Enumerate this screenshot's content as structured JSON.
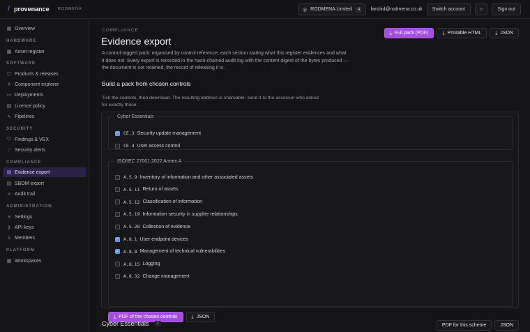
{
  "brand": {
    "name": "provenance",
    "org": "RODMENA"
  },
  "top": {
    "tenant": "RODMENA Limited",
    "tenant_count": "4",
    "email": "farshid@rodmena.co.uk",
    "switch": "Switch account",
    "signout": "Sign out"
  },
  "sidebar": {
    "overview": "Overview",
    "sec_hardware": "HARDWARE",
    "asset_register": "Asset register",
    "sec_software": "SOFTWARE",
    "products": "Products & releases",
    "component_explorer": "Component explorer",
    "deployments": "Deployments",
    "licence_policy": "Licence policy",
    "pipelines": "Pipelines",
    "sec_security": "SECURITY",
    "findings": "Findings & VEX",
    "security_alerts": "Security alerts",
    "sec_compliance": "COMPLIANCE",
    "evidence_export": "Evidence export",
    "sbom_export": "SBOM export",
    "audit_trail": "Audit trail",
    "sec_administration": "ADMINISTRATION",
    "settings": "Settings",
    "api_keys": "API keys",
    "members": "Members",
    "sec_platform": "PLATFORM",
    "workspaces": "Workspaces"
  },
  "page": {
    "eyebrow": "COMPLIANCE",
    "title": "Evidence export",
    "lead": "A control-tagged pack: organised by control reference, each section stating what this register evidences and what it does not. Every export is recorded in the hash-chained audit log with the content digest of the bytes produced — the document is not retained, the record of releasing it is.",
    "btn_full_pack": "Full pack (PDF)",
    "btn_printable": "Printable HTML",
    "btn_json": "JSON",
    "build_title": "Build a pack from chosen controls",
    "build_hint": "Tick the controls, then download. The resulting address is shareable: send it to the assessor who asked for exactly those."
  },
  "groups": {
    "ce": {
      "legend": "Cyber Essentials",
      "controls": [
        {
          "code": "CE.3",
          "label": "Security update management",
          "checked": true
        },
        {
          "code": "CE.4",
          "label": "User access control",
          "checked": false
        }
      ]
    },
    "iso": {
      "legend": "ISO/IEC 27001:2022 Annex A",
      "controls": [
        {
          "code": "A.5.9",
          "label": "Inventory of information and other associated assets",
          "checked": false
        },
        {
          "code": "A.5.11",
          "label": "Return of assets",
          "checked": false
        },
        {
          "code": "A.5.12",
          "label": "Classification of information",
          "checked": false
        },
        {
          "code": "A.5.19",
          "label": "Information security in supplier relationships",
          "checked": false
        },
        {
          "code": "A.5.28",
          "label": "Collection of evidence",
          "checked": false
        },
        {
          "code": "A.8.1",
          "label": "User endpoint devices",
          "checked": true
        },
        {
          "code": "A.8.8",
          "label": "Management of technical vulnerabilities",
          "checked": true
        },
        {
          "code": "A.8.15",
          "label": "Logging",
          "checked": false
        },
        {
          "code": "A.8.32",
          "label": "Change management",
          "checked": false
        }
      ]
    }
  },
  "panel": {
    "btn_pdf_chosen": "PDF of the chosen controls",
    "btn_json": "JSON"
  },
  "scheme": {
    "title": "Cyber Essentials",
    "count": "2",
    "btn_pdf": "PDF for this scheme",
    "btn_json": "JSON"
  }
}
